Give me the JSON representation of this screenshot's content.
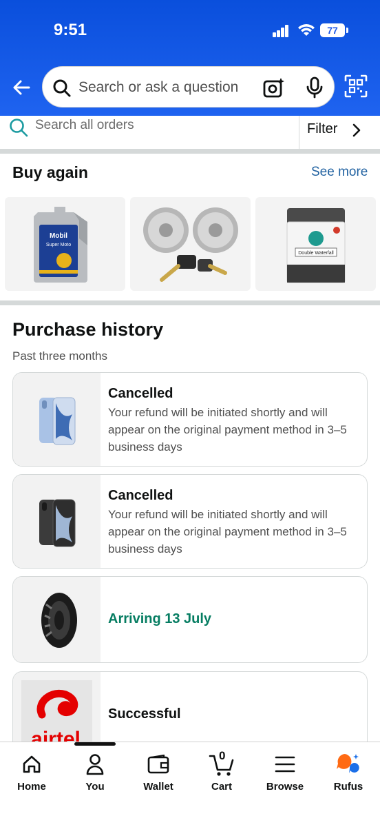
{
  "status_bar": {
    "time": "9:51",
    "battery": "77"
  },
  "search": {
    "placeholder": "Search or ask a question"
  },
  "orders_search": {
    "placeholder": "Search all orders",
    "filter_label": "Filter"
  },
  "buy_again": {
    "title": "Buy again",
    "see_more": "See more",
    "items": [
      {
        "name": "motor-oil",
        "brand_text": "Mobil",
        "sub_text": "Super Moto"
      },
      {
        "name": "padlocks"
      },
      {
        "name": "washing-machine",
        "label_text": "Double Waterfall"
      }
    ]
  },
  "purchase_history": {
    "title": "Purchase history",
    "subtitle": "Past three months",
    "orders": [
      {
        "status": "Cancelled",
        "description": "Your refund will be initiated shortly and will appear on the original payment method in 3–5 business days",
        "product": "phone-blue"
      },
      {
        "status": "Cancelled",
        "description": "Your refund will be initiated shortly and will appear on the original payment method in 3–5 business days",
        "product": "phone-black"
      },
      {
        "status": "Arriving 13 July",
        "description": "",
        "product": "tyre"
      },
      {
        "status": "Successful",
        "description": "",
        "product": "airtel",
        "logo_text": "airtel"
      }
    ]
  },
  "bottom_nav": {
    "items": [
      {
        "label": "Home",
        "icon": "home-icon"
      },
      {
        "label": "You",
        "icon": "person-icon"
      },
      {
        "label": "Wallet",
        "icon": "wallet-icon"
      },
      {
        "label": "Cart",
        "icon": "cart-icon",
        "badge": "0"
      },
      {
        "label": "Browse",
        "icon": "menu-icon"
      },
      {
        "label": "Rufus",
        "icon": "rufus-icon"
      }
    ]
  },
  "colors": {
    "header_blue": "#1f5ae8",
    "link_blue": "#2162a1",
    "arriving_green": "#067d62",
    "airtel_red": "#e40000",
    "rufus_orange": "#ff6a13"
  }
}
